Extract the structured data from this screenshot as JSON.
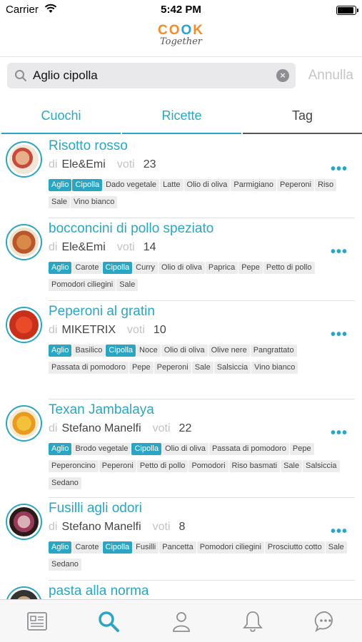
{
  "status_bar": {
    "carrier": "Carrier",
    "time": "5:42 PM",
    "battery_level": 0.95
  },
  "app": {
    "logo_top": "COOK",
    "logo_bottom": "Together"
  },
  "search": {
    "value": "Aglio cipolla",
    "cancel_label": "Annulla"
  },
  "tabs": [
    {
      "label": "Cuochi",
      "state": "active"
    },
    {
      "label": "Ricette",
      "state": "active"
    },
    {
      "label": "Tag",
      "state": "selected"
    }
  ],
  "labels": {
    "by": "di",
    "votes": "voti"
  },
  "recipes": [
    {
      "title": "Risotto rosso",
      "author": "Ele&Emi",
      "votes": "23",
      "tags": [
        {
          "t": "Aglio",
          "hl": true
        },
        {
          "t": "Cipolla",
          "hl": true
        },
        {
          "t": "Dado vegetale"
        },
        {
          "t": "Latte"
        },
        {
          "t": "Olio di oliva"
        },
        {
          "t": "Parmigiano"
        },
        {
          "t": "Peperoni"
        },
        {
          "t": "Riso"
        },
        {
          "t": "Sale"
        },
        {
          "t": "Vino bianco"
        }
      ]
    },
    {
      "title": "bocconcini di pollo speziato",
      "author": "Ele&Emi",
      "votes": "14",
      "tags": [
        {
          "t": "Aglio",
          "hl": true
        },
        {
          "t": "Carote"
        },
        {
          "t": "Cipolla",
          "hl": true
        },
        {
          "t": "Curry"
        },
        {
          "t": "Olio di oliva"
        },
        {
          "t": "Paprica"
        },
        {
          "t": "Pepe"
        },
        {
          "t": "Petto di pollo"
        },
        {
          "t": "Pomodori ciliegini"
        },
        {
          "t": "Sale"
        }
      ]
    },
    {
      "title": "Peperoni al gratin",
      "author": "MIKETRIX",
      "votes": "10",
      "tags": [
        {
          "t": "Aglio",
          "hl": true
        },
        {
          "t": "Basilico"
        },
        {
          "t": "Cipolla",
          "hl": true
        },
        {
          "t": "Noce"
        },
        {
          "t": "Olio di oliva"
        },
        {
          "t": "Olive nere"
        },
        {
          "t": "Pangrattato"
        },
        {
          "t": "Passata di pomodoro"
        },
        {
          "t": "Pepe"
        },
        {
          "t": "Peperoni"
        },
        {
          "t": "Sale"
        },
        {
          "t": "Salsiccia"
        },
        {
          "t": "Vino bianco"
        }
      ]
    },
    {
      "title": "Texan Jambalaya",
      "author": "Stefano Manelfi",
      "votes": "22",
      "tags": [
        {
          "t": "Aglio",
          "hl": true
        },
        {
          "t": "Brodo vegetale"
        },
        {
          "t": "Cipolla",
          "hl": true
        },
        {
          "t": "Olio di oliva"
        },
        {
          "t": "Passata di pomodoro"
        },
        {
          "t": "Pepe"
        },
        {
          "t": "Peperoncino"
        },
        {
          "t": "Peperoni"
        },
        {
          "t": "Petto di pollo"
        },
        {
          "t": "Pomodori"
        },
        {
          "t": "Riso basmati"
        },
        {
          "t": "Sale"
        },
        {
          "t": "Salsiccia"
        },
        {
          "t": "Sedano"
        }
      ]
    },
    {
      "title": "Fusilli agli odori",
      "author": "Stefano Manelfi",
      "votes": "8",
      "tags": [
        {
          "t": "Aglio",
          "hl": true
        },
        {
          "t": "Carote"
        },
        {
          "t": "Cipolla",
          "hl": true
        },
        {
          "t": "Fusilli"
        },
        {
          "t": "Pancetta"
        },
        {
          "t": "Pomodori ciliegini"
        },
        {
          "t": "Prosciutto cotto"
        },
        {
          "t": "Sale"
        },
        {
          "t": "Sedano"
        }
      ]
    },
    {
      "title": "pasta alla norma",
      "author": "",
      "votes": "",
      "tags": []
    }
  ],
  "colors": {
    "accent": "#2aa6c4",
    "logo_orange": "#f28c28",
    "logo_blue": "#2a9fd6"
  },
  "tabbar": [
    {
      "icon": "news-feed-icon",
      "active": false
    },
    {
      "icon": "search-icon",
      "active": true
    },
    {
      "icon": "profile-icon",
      "active": false
    },
    {
      "icon": "bell-icon",
      "active": false
    },
    {
      "icon": "chat-bubble-icon",
      "active": false
    }
  ]
}
